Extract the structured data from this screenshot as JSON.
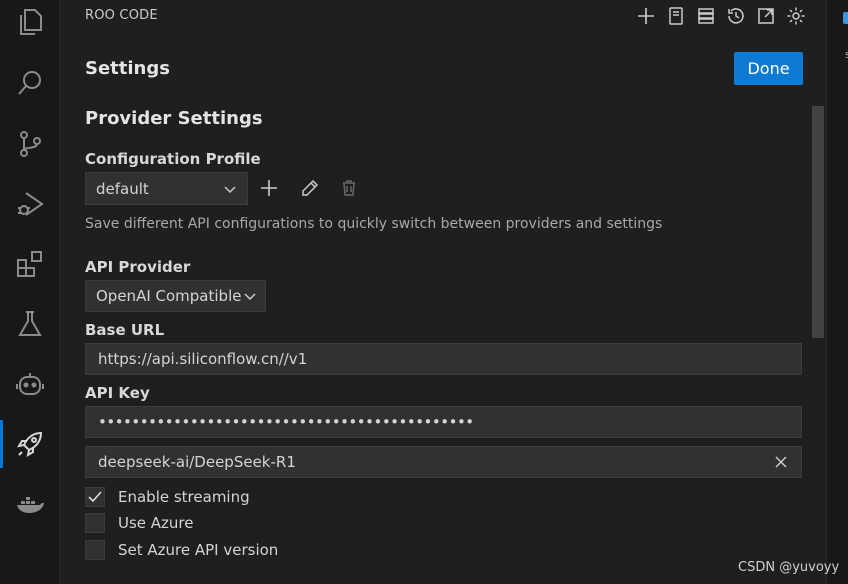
{
  "panel": {
    "title": "ROO CODE",
    "toolbar": [
      "plus-icon",
      "prompts-icon",
      "mcp-servers-icon",
      "history-icon",
      "popout-icon",
      "gear-icon"
    ]
  },
  "settings": {
    "title": "Settings",
    "done_label": "Done",
    "section_title": "Provider Settings",
    "config_profile": {
      "label": "Configuration Profile",
      "selected": "default",
      "hint": "Save different API configurations to quickly switch between providers and settings"
    },
    "api_provider": {
      "label": "API Provider",
      "selected": "OpenAI Compatible"
    },
    "base_url": {
      "label": "Base URL",
      "value": "https://api.siliconflow.cn//v1"
    },
    "api_key": {
      "label": "API Key",
      "value": "•••••••••••••••••••••••••••••••••••••••••••••"
    },
    "model": {
      "value": "deepseek-ai/DeepSeek-R1"
    },
    "checkboxes": [
      {
        "label": "Enable streaming",
        "checked": true
      },
      {
        "label": "Use Azure",
        "checked": false
      },
      {
        "label": "Set Azure API version",
        "checked": false
      }
    ]
  },
  "activity_bar": [
    "explorer-icon",
    "search-icon",
    "source-control-icon",
    "run-debug-icon",
    "extensions-icon",
    "testing-icon",
    "copilot-icon",
    "roo-code-rocket-icon",
    "docker-icon"
  ],
  "colors": {
    "accent": "#0e7ad3",
    "background": "#1f1f1f",
    "input_bg": "#313131"
  },
  "watermark": "CSDN @yuvoyy"
}
